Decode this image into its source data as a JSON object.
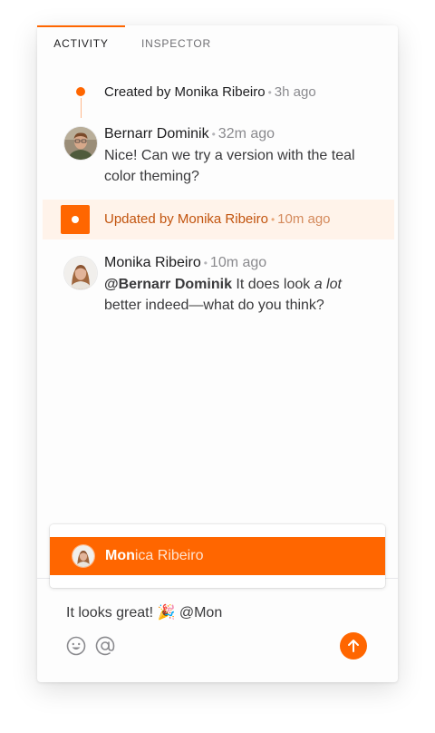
{
  "tabs": [
    {
      "label": "ACTIVITY",
      "active": true
    },
    {
      "label": "INSPECTOR",
      "active": false
    }
  ],
  "timeline": [
    {
      "type": "created",
      "text": "Created by Monika Ribeiro",
      "time": "3h ago"
    },
    {
      "type": "comment",
      "author": "Bernarr Dominik",
      "time": "32m ago",
      "body": "Nice! Can we try a version with the teal color theming?"
    },
    {
      "type": "updated",
      "text": "Updated by Monika Ribeiro",
      "time": "10m ago"
    },
    {
      "type": "comment",
      "author": "Monika Ribeiro",
      "time": "10m ago",
      "mention": "@Bernarr Dominik",
      "body_a": "It does look",
      "body_em": "a lot",
      "body_b": "better indeed—what do you think?"
    }
  ],
  "separator": "•",
  "mention_dropdown": {
    "match": "Mon",
    "rest": "ica Ribeiro"
  },
  "composer": {
    "text": "It looks great! 🎉 @Mon"
  },
  "icons": {
    "emoji": "smiley-icon",
    "mention": "at-sign-icon",
    "send": "arrow-up-icon"
  },
  "colors": {
    "accent": "#ff6600",
    "update_background": "#fff3ea",
    "update_text": "#c2540e"
  }
}
